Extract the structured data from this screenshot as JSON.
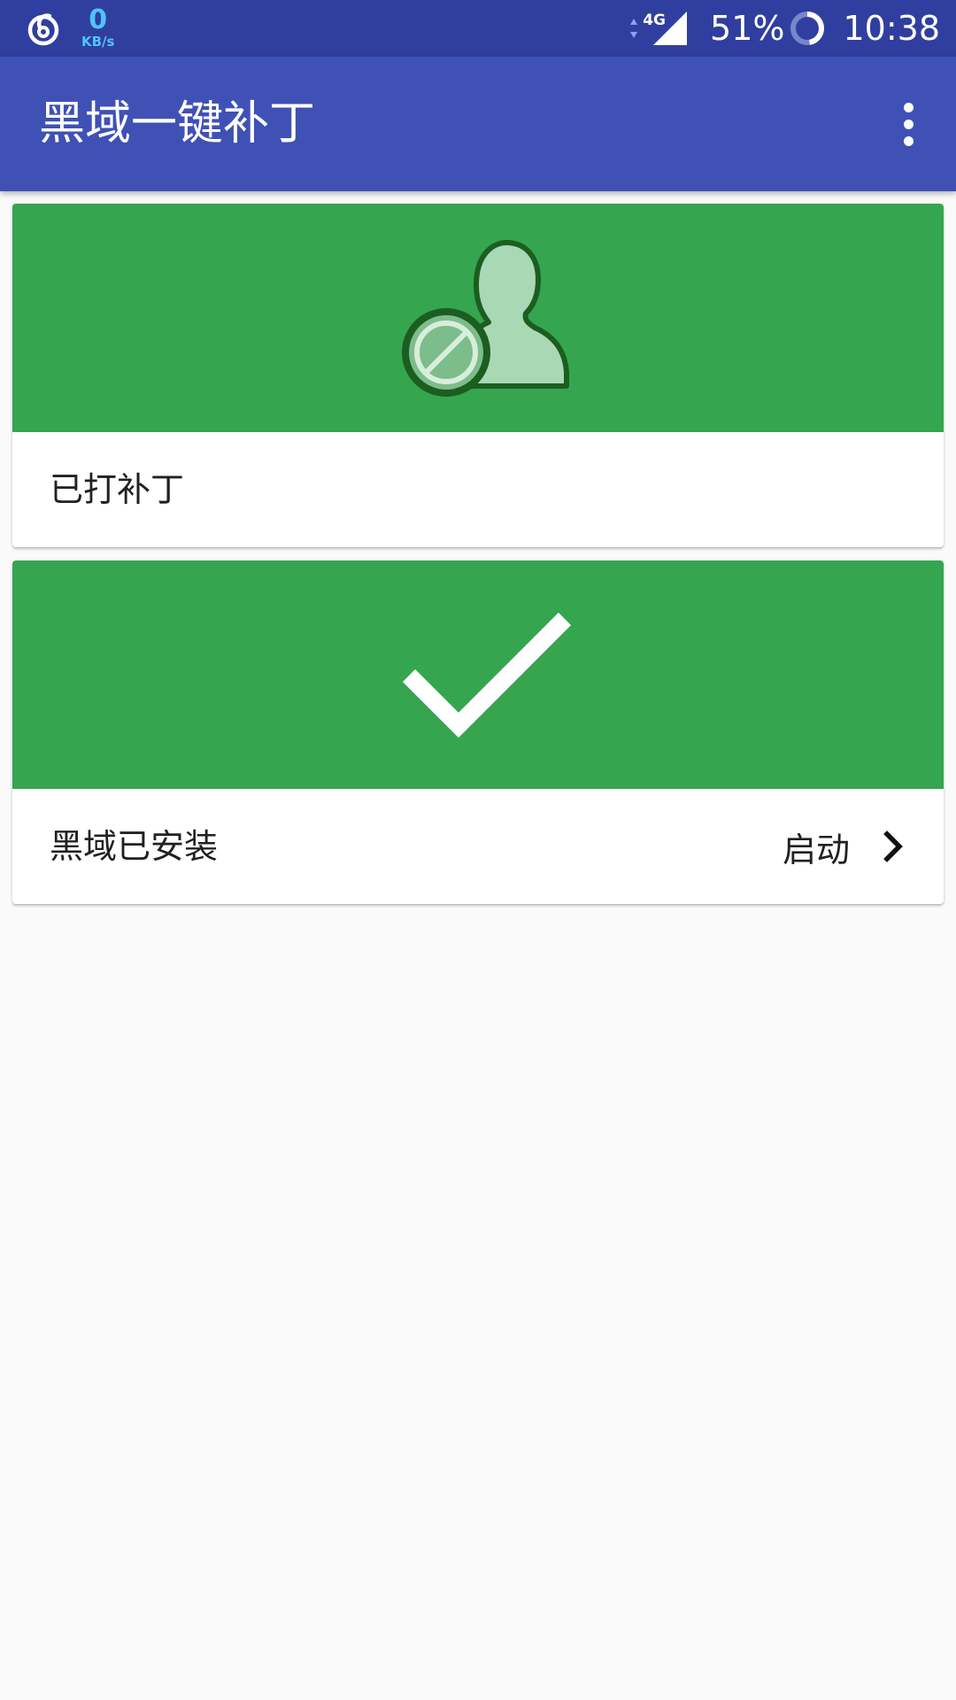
{
  "status_bar": {
    "net_speed_value": "0",
    "net_speed_unit": "KB/s",
    "network_type": "4G",
    "battery_percent": "51%",
    "time": "10:38",
    "icons": [
      "netease-music-icon",
      "data-activity-icon",
      "signal-icon",
      "battery-ring-icon"
    ]
  },
  "app_bar": {
    "title": "黑域一键补丁",
    "overflow_icon": "more-vert-icon"
  },
  "cards": [
    {
      "hero_icon": "user-blocked-icon",
      "label": "已打补丁"
    },
    {
      "hero_icon": "checkmark-icon",
      "label": "黑域已安装",
      "action_label": "启动",
      "action_icon": "chevron-right-icon"
    }
  ],
  "colors": {
    "status_bar": "#303f9f",
    "app_bar": "#3f51b5",
    "card_hero": "#35a54f",
    "background": "#fafafa",
    "speed_text": "#4fc3f7"
  }
}
